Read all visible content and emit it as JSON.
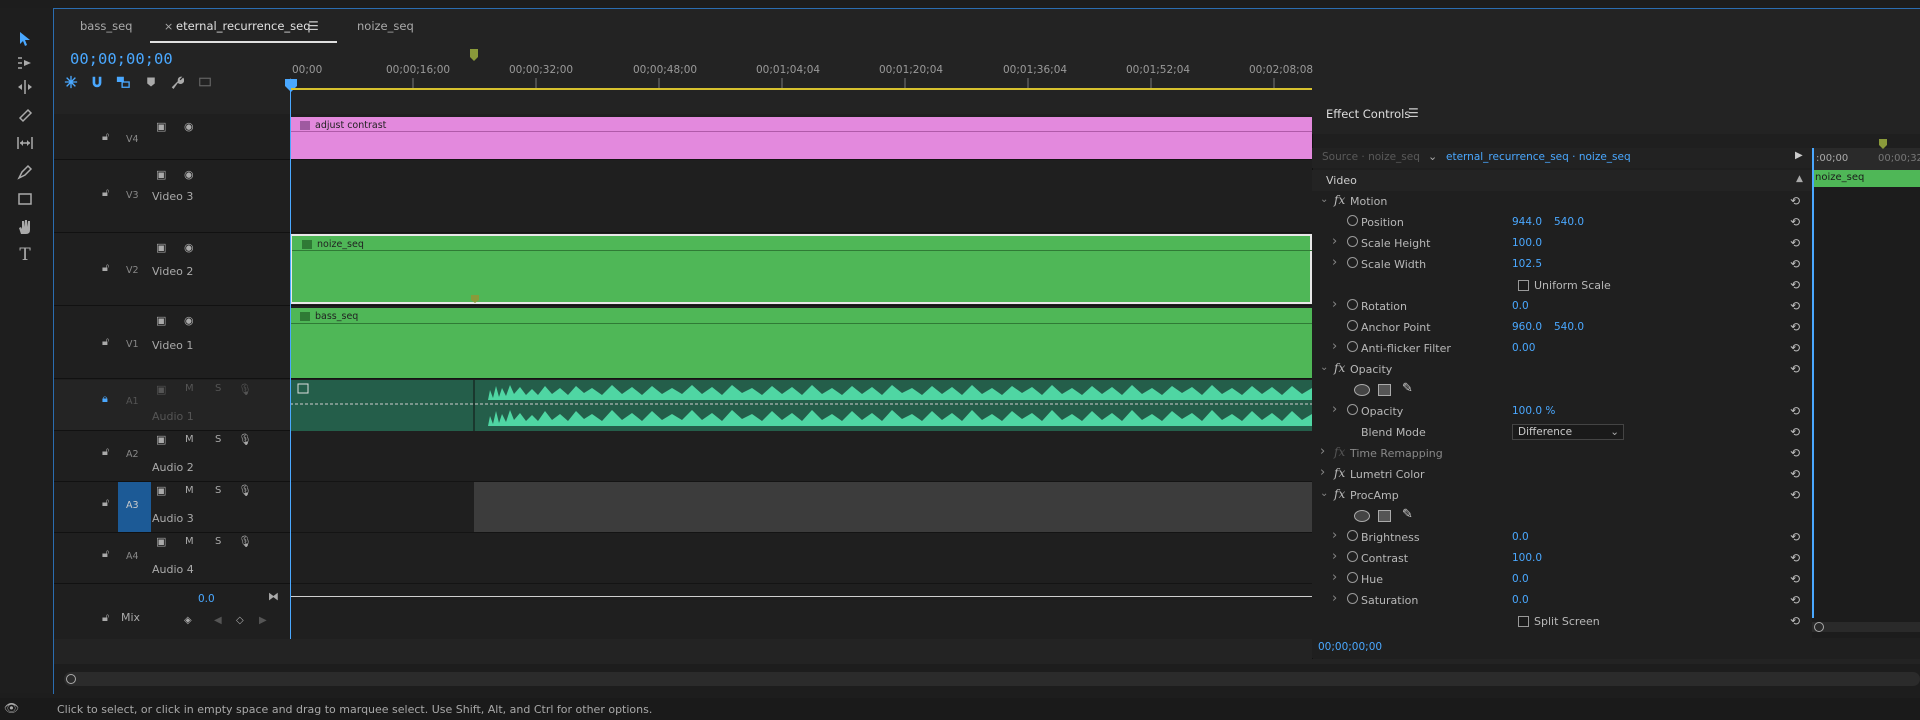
{
  "tabs": [
    {
      "label": "bass_seq",
      "active": false
    },
    {
      "label": "eternal_recurrence_seq",
      "active": true
    },
    {
      "label": "noize_seq",
      "active": false
    }
  ],
  "timeline": {
    "timecode": "00;00;00;00",
    "ruler_labels": [
      "00;00",
      "00;00;16;00",
      "00;00;32;00",
      "00;00;48;00",
      "00;01;04;04",
      "00;01;20;04",
      "00;01;36;04",
      "00;01;52;04",
      "00;02;08;08"
    ],
    "tracks": [
      {
        "id": "V4",
        "name": ""
      },
      {
        "id": "V3",
        "name": "Video 3"
      },
      {
        "id": "V2",
        "name": "Video 2"
      },
      {
        "id": "V1",
        "name": "Video 1"
      },
      {
        "id": "A1",
        "name": "Audio 1",
        "mute": "M",
        "solo": "S"
      },
      {
        "id": "A2",
        "name": "Audio 2",
        "mute": "M",
        "solo": "S"
      },
      {
        "id": "A3",
        "name": "Audio 3",
        "mute": "M",
        "solo": "S"
      },
      {
        "id": "A4",
        "name": "Audio 4",
        "mute": "M",
        "solo": "S"
      },
      {
        "id": "",
        "name": "Mix"
      }
    ],
    "mix_value": "0.0",
    "clips": {
      "v4": "adjust contrast",
      "v2": "noize_seq",
      "v1": "bass_seq"
    },
    "colors": {
      "adjustment": "#e389dd",
      "video": "#4fb757",
      "audio": "#2a8a68"
    }
  },
  "effect_controls": {
    "title": "Effect Controls",
    "source_label": "Source · noize_seq",
    "sequence_label": "eternal_recurrence_seq · noize_seq",
    "section": "Video",
    "mini_timecode": ":00;00",
    "mini_timecode2": "00;00;32",
    "mini_clip": "noize_seq",
    "footer_timecode": "00;00;00;00",
    "params": [
      {
        "kind": "group",
        "name": "Motion",
        "chev": "﹀"
      },
      {
        "kind": "param",
        "name": "Position",
        "v1": "944.0",
        "v2": "540.0"
      },
      {
        "kind": "param",
        "name": "Scale Height",
        "v1": "100.0",
        "exp": true
      },
      {
        "kind": "param",
        "name": "Scale Width",
        "v1": "102.5",
        "exp": true
      },
      {
        "kind": "check",
        "name": "Uniform Scale"
      },
      {
        "kind": "param",
        "name": "Rotation",
        "v1": "0.0",
        "exp": true
      },
      {
        "kind": "param",
        "name": "Anchor Point",
        "v1": "960.0",
        "v2": "540.0"
      },
      {
        "kind": "param",
        "name": "Anti-flicker Filter",
        "v1": "0.00",
        "exp": true
      },
      {
        "kind": "group",
        "name": "Opacity",
        "chev": "﹀"
      },
      {
        "kind": "masks"
      },
      {
        "kind": "param",
        "name": "Opacity",
        "v1": "100.0 %",
        "exp": true
      },
      {
        "kind": "select",
        "name": "Blend Mode",
        "v1": "Difference"
      },
      {
        "kind": "group",
        "name": "Time Remapping",
        "chev": "›",
        "dim": true
      },
      {
        "kind": "group",
        "name": "Lumetri Color",
        "chev": "›"
      },
      {
        "kind": "group",
        "name": "ProcAmp",
        "chev": "﹀"
      },
      {
        "kind": "masks"
      },
      {
        "kind": "param",
        "name": "Brightness",
        "v1": "0.0",
        "exp": true
      },
      {
        "kind": "param",
        "name": "Contrast",
        "v1": "100.0",
        "exp": true
      },
      {
        "kind": "param",
        "name": "Hue",
        "v1": "0.0",
        "exp": true
      },
      {
        "kind": "param",
        "name": "Saturation",
        "v1": "0.0",
        "exp": true
      },
      {
        "kind": "check",
        "name": "Split Screen"
      }
    ]
  },
  "status": "Click to select, or click in empty space and drag to marquee select. Use Shift, Alt, and Ctrl for other options."
}
